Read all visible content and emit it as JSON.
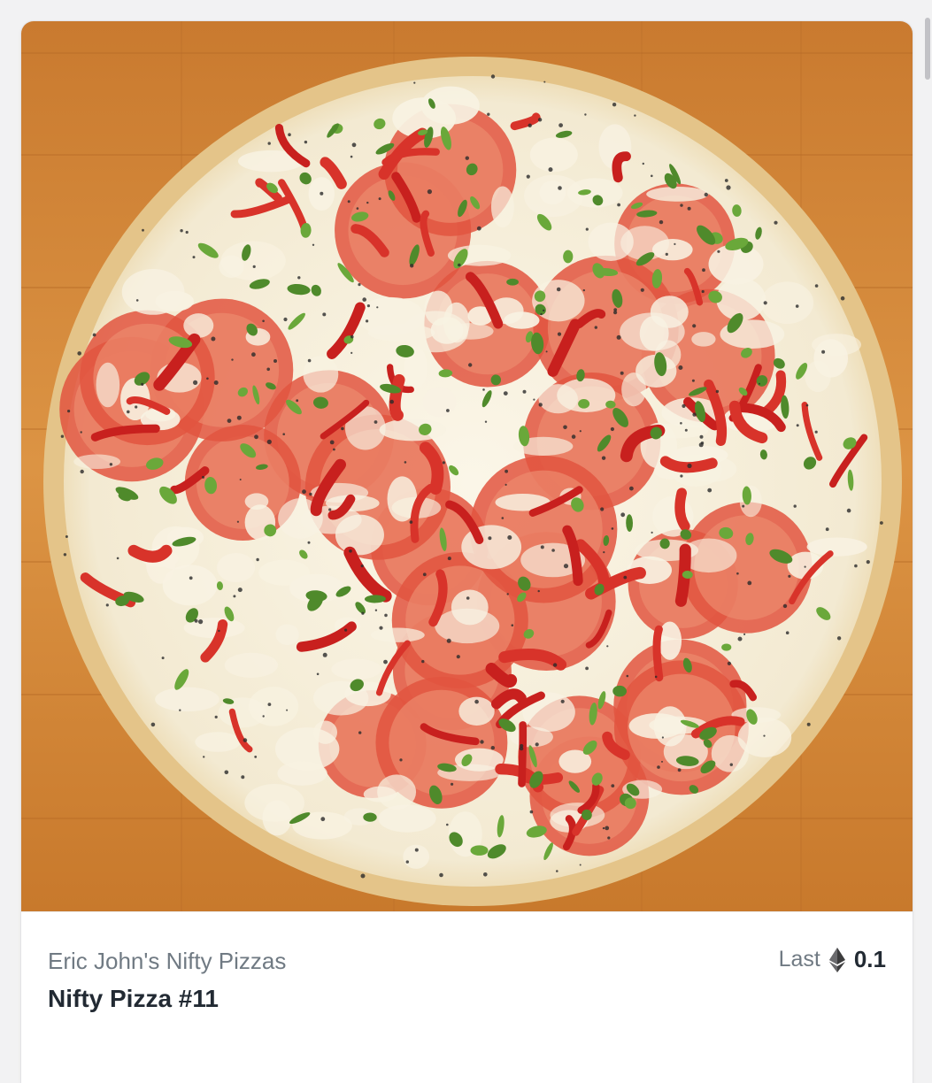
{
  "card": {
    "collection_name": "Eric John's Nifty Pizzas",
    "item_name": "Nifty Pizza #11",
    "price_label": "Last",
    "price_value": "0.1",
    "currency_icon": "ethereum-icon"
  },
  "media": {
    "image_subject": "pizza-image"
  },
  "colors": {
    "board": "#d98e3f",
    "crust": "#e9c98f",
    "cheese": "#f6f0e0",
    "tomato": "#d8332a",
    "basil": "#4f8a2b",
    "text_primary": "#222a33",
    "text_secondary": "#707a83"
  }
}
